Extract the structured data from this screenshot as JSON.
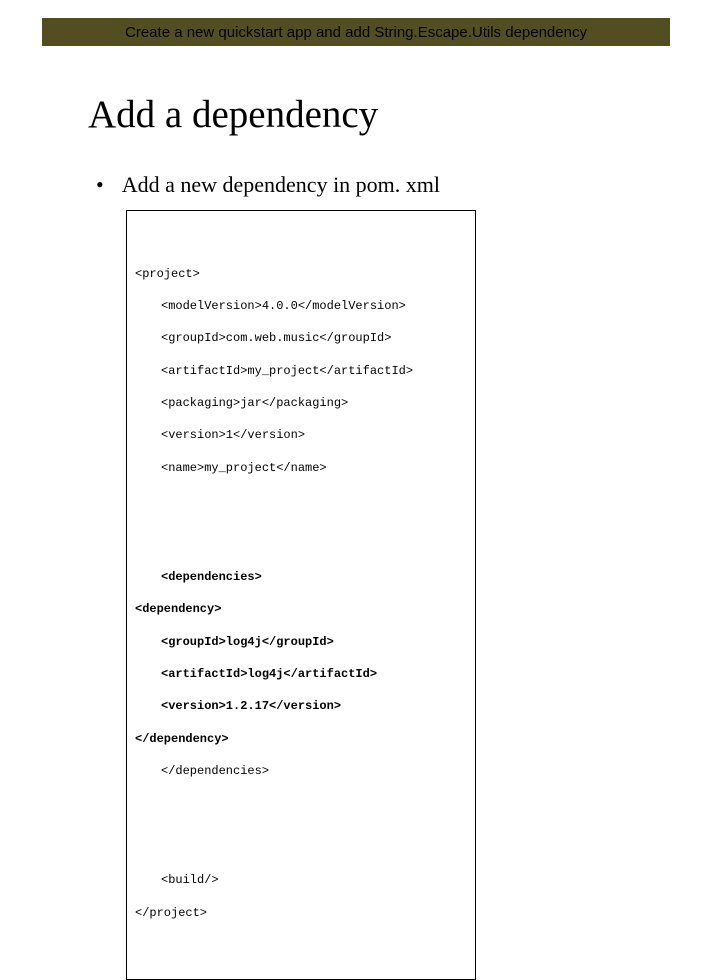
{
  "banner": {
    "text": "Create a new quickstart app and add String.Escape.Utils dependency"
  },
  "title": "Add a dependency",
  "bullet": {
    "marker": "•",
    "text": "Add a new dependency in pom. xml"
  },
  "code": {
    "block1": {
      "l1": "<project>",
      "l2": "<modelVersion>4.0.0</modelVersion>",
      "l3": "<groupId>com.web.music</groupId>",
      "l4": "<artifactId>my_project</artifactId>",
      "l5": "<packaging>jar</packaging>",
      "l6": "<version>1</version>",
      "l7": "<name>my_project</name>"
    },
    "block2": {
      "l1": "<dependencies>",
      "l2": "<dependency>",
      "l3": "<groupId>log4j</groupId>",
      "l4": "<artifactId>log4j</artifactId>",
      "l5": "<version>1.2.17</version>",
      "l6": "</dependency>",
      "l7": "</dependencies>"
    },
    "block3": {
      "l1": "<build/>",
      "l2": "</project>"
    }
  }
}
